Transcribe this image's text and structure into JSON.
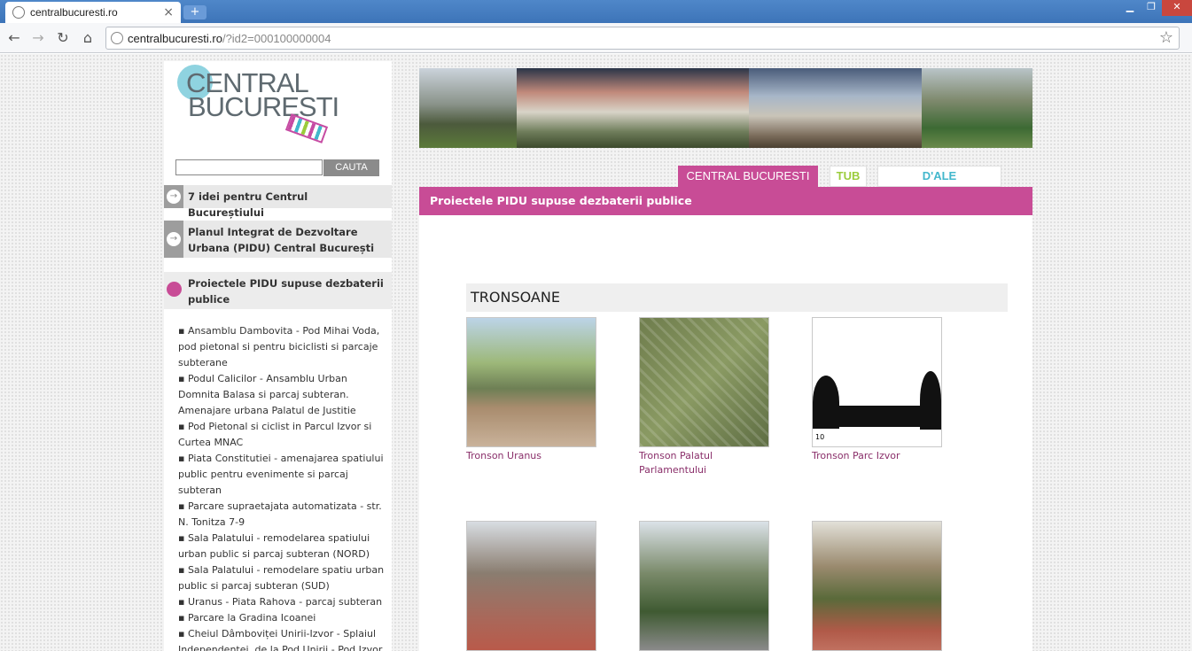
{
  "browser": {
    "tab_title": "centralbucuresti.ro",
    "close_glyph": "×",
    "new_tab_glyph": "+",
    "url_host": "centralbucuresti.ro",
    "url_path": "/?id2=000100000004"
  },
  "header": {
    "logo_line1": "CENTRAL",
    "logo_line2": "BUCURESTI",
    "search_button": "CAUTA",
    "search_value": ""
  },
  "sidebar": {
    "items": [
      {
        "label": "7 idei pentru Centrul Bucureștiului"
      },
      {
        "label": "Planul Integrat de Dezvoltare Urbana (PIDU) Central București"
      },
      {
        "label": "Proiectele PIDU supuse dezbaterii publice"
      }
    ],
    "subitems": [
      "▪ Ansamblu Dambovita - Pod Mihai Voda, pod pietonal si pentru biciclisti si parcaje subterane",
      "▪ Podul Calicilor - Ansamblu Urban Domnita Balasa si parcaj subteran. Amenajare urbana Palatul de Justitie",
      "▪ Pod Pietonal si ciclist in Parcul Izvor si Curtea MNAC",
      "▪ Piata Constitutiei - amenajarea spatiului public pentru evenimente si parcaj subteran",
      "▪ Parcare supraetajata automatizata - str. N. Tonitza 7-9",
      "▪ Sala Palatului - remodelarea spatiului urban public si parcaj subteran (NORD)",
      "▪ Sala Palatului - remodelare spatiu urban public si parcaj subteran (SUD)",
      "▪ Uranus - Piata Rahova - parcaj subteran",
      "▪ Parcare la Gradina Icoanei",
      "▪ Cheiul Dâmboviței Unirii-Izvor - Splaiul Independenței, de la Pod Unirii - Pod Izvor,"
    ]
  },
  "tabs": {
    "central": "CENTRAL BUCURESTI",
    "tub": "TUB",
    "dale": "D'ALE BUCURESTIULUI"
  },
  "main": {
    "heading": "Proiectele PIDU supuse dezbaterii publice",
    "section_title": "TRONSOANE",
    "thumbs": [
      {
        "caption": "Tronson Uranus"
      },
      {
        "caption": "Tronson Palatul Parlamentului"
      },
      {
        "caption": "Tronson Parc Izvor"
      },
      {
        "caption": ""
      },
      {
        "caption": ""
      },
      {
        "caption": ""
      }
    ],
    "scale_label": "10"
  }
}
